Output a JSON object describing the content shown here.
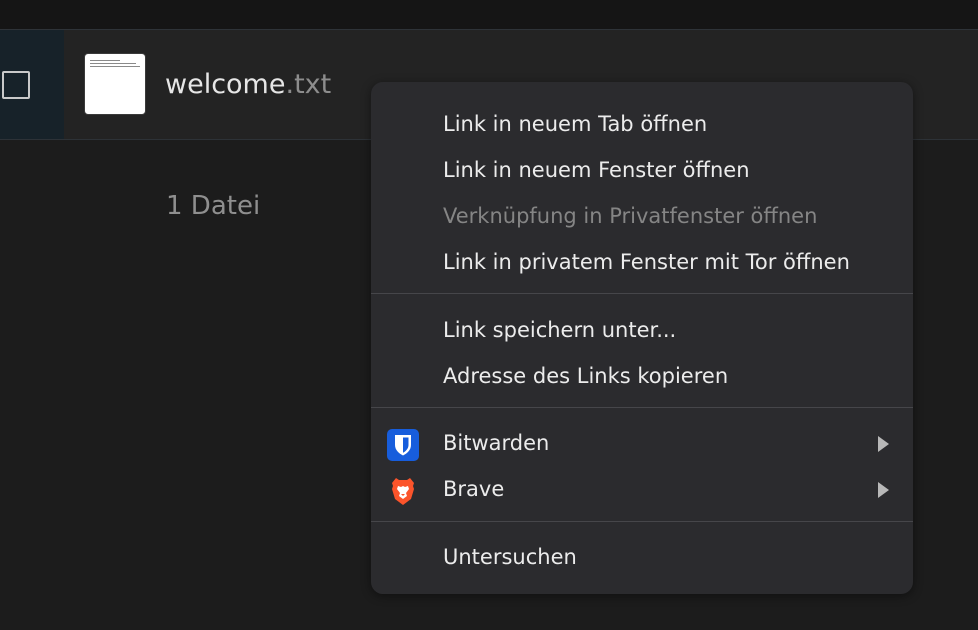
{
  "file": {
    "name_base": "welcome",
    "name_ext": ".txt",
    "count_label": "1 Datei"
  },
  "context_menu": {
    "items": [
      {
        "label": "Link in neuem Tab öffnen",
        "enabled": true
      },
      {
        "label": "Link in neuem Fenster öffnen",
        "enabled": true
      },
      {
        "label": "Verknüpfung in Privatfenster öffnen",
        "enabled": false
      },
      {
        "label": "Link in privatem Fenster mit Tor öffnen",
        "enabled": true
      },
      {
        "label": "Link speichern unter...",
        "enabled": true
      },
      {
        "label": "Adresse des Links kopieren",
        "enabled": true
      },
      {
        "label": "Bitwarden",
        "enabled": true,
        "icon": "bitwarden-icon",
        "submenu": true
      },
      {
        "label": "Brave",
        "enabled": true,
        "icon": "brave-icon",
        "submenu": true
      },
      {
        "label": "Untersuchen",
        "enabled": true
      }
    ]
  },
  "colors": {
    "background": "#1c1c1c",
    "menu_background": "#2b2b2e",
    "bitwarden_blue": "#175ddc",
    "brave_orange": "#fb542b"
  }
}
